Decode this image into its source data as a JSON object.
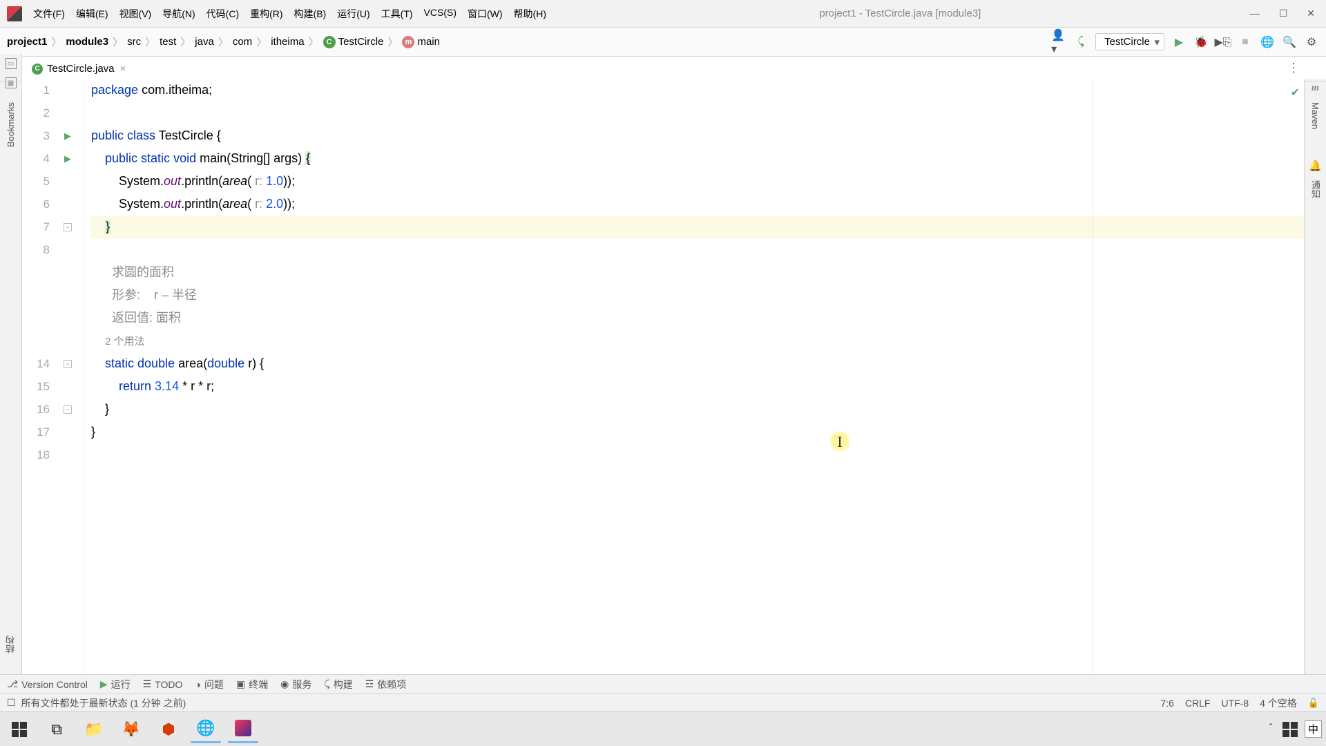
{
  "title": "project1 - TestCircle.java [module3]",
  "menu": {
    "file": "文件(F)",
    "edit": "编辑(E)",
    "view": "视图(V)",
    "nav": "导航(N)",
    "code": "代码(C)",
    "refactor": "重构(R)",
    "build": "构建(B)",
    "run": "运行(U)",
    "tools": "工具(T)",
    "vcs": "VCS(S)",
    "window": "窗口(W)",
    "help": "帮助(H)"
  },
  "breadcrumb": {
    "p1": "project1",
    "p2": "module3",
    "p3": "src",
    "p4": "test",
    "p5": "java",
    "p6": "com",
    "p7": "itheima",
    "cls": "TestCircle",
    "method": "main"
  },
  "run_config": "TestCircle",
  "tab": {
    "name": "TestCircle.java"
  },
  "right_tools": {
    "maven": "Maven",
    "notify": "通知"
  },
  "left_tools": {
    "bookmarks": "Bookmarks",
    "structure": "结构"
  },
  "code": {
    "l1_kw": "package",
    "l1_rest": " com.itheima;",
    "l3_a": "public ",
    "l3_b": "class ",
    "l3_c": "TestCircle {",
    "l4_a": "public ",
    "l4_b": "static ",
    "l4_c": "void ",
    "l4_d": "main",
    "l4_e": "(String[] args) ",
    "l4_brace": "{",
    "l5_a": "System.",
    "l5_out": "out",
    "l5_b": ".println(",
    "l5_area": "area",
    "l5_c": "( ",
    "l5_hint": "r:",
    "l5_num": " 1.0",
    "l5_d": "));",
    "l6_a": "System.",
    "l6_out": "out",
    "l6_b": ".println(",
    "l6_area": "area",
    "l6_c": "( ",
    "l6_hint": "r:",
    "l6_num": " 2.0",
    "l6_d": "));",
    "l7": "}",
    "doc1": "求圆的面积",
    "doc2": "形参:    r – 半径",
    "doc3": "返回值: 面积",
    "usages": "2 个用法",
    "l14_a": "static ",
    "l14_b": "double ",
    "l14_c": "area",
    "l14_d": "(",
    "l14_e": "double ",
    "l14_f": "r) {",
    "l15_a": "return ",
    "l15_num": "3.14",
    "l15_b": " * r * r;",
    "l16": "}",
    "l17": "}"
  },
  "line_numbers": {
    "1": "1",
    "2": "2",
    "3": "3",
    "4": "4",
    "5": "5",
    "6": "6",
    "7": "7",
    "8": "8",
    "14": "14",
    "15": "15",
    "16": "16",
    "17": "17",
    "18": "18"
  },
  "bottom": {
    "vc": "Version Control",
    "run": "运行",
    "todo": "TODO",
    "problem": "问题",
    "terminal": "终端",
    "service": "服务",
    "build": "构建",
    "deps": "依赖项"
  },
  "status": {
    "msg": "所有文件都处于最新状态 (1 分钟 之前)",
    "pos": "7:6",
    "crlf": "CRLF",
    "enc": "UTF-8",
    "indent": "4 个空格"
  },
  "ime": "中"
}
